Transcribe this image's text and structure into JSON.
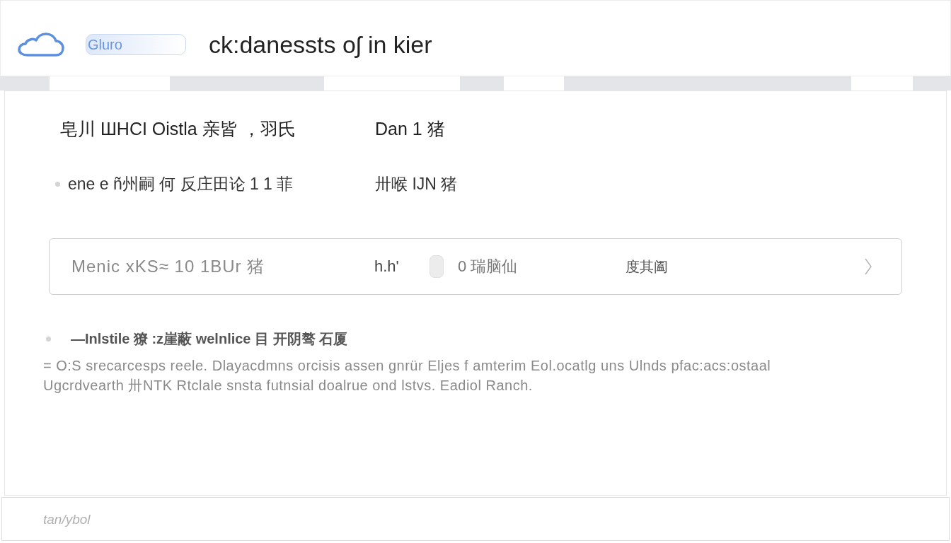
{
  "header": {
    "brand": "Gluro",
    "title": "ck:danessts oʃ in kier"
  },
  "details": [
    {
      "label": "皂川 ШHCI Oistla 亲皆 ，羽氏",
      "value": "Dan 1 猪",
      "bullet": false
    },
    {
      "label": "ene e ñ州嗣 何 反庄田论 1 1 菲",
      "value": "卅喉 IJN 猪",
      "bullet": true
    }
  ],
  "summary_row": {
    "label": "Menic xKS≈ 10 1BUr 猪",
    "value": "h.h'",
    "count": "0 瑞脑仙",
    "extra": "度其阖"
  },
  "note": {
    "heading": "—Inlstile 獠 :z崖蔽 welnlice 目 开阴骜 石厦",
    "body": "= O:S srecarcesps reele. Dlayacdmns orcisis  assen gnrür Eljes f amterim Eol.ocatlg uns  Ulnds  pfac:acs:ostaal Ugcrdvearth 卅NTK Rtclale snsta futnsial doalrue ond lstvs. Eadiol Ranch."
  },
  "footer": {
    "text": "tan/ybol"
  }
}
